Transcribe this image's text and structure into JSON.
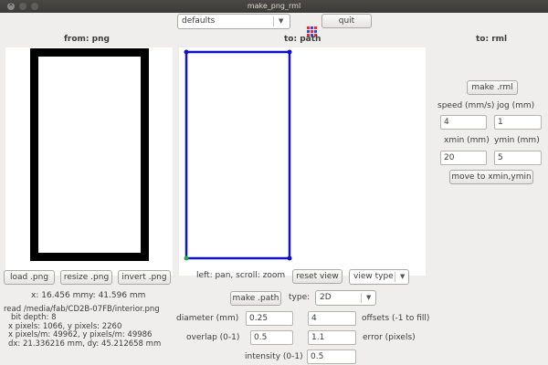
{
  "window": {
    "title": "make_png_rml"
  },
  "toolbar": {
    "defaults_value": "defaults",
    "quit_label": "quit"
  },
  "headings": {
    "from": "from: png",
    "to_path": "to: path",
    "to_rml": "to: rml"
  },
  "png_buttons": {
    "load": "load .png",
    "resize": "resize .png",
    "invert": "invert .png"
  },
  "cursor": {
    "x": "x: 16.456 mm",
    "y": "y: 41.596 mm"
  },
  "info_lines": [
    "read /media/fab/CD2B-07FB/interior.png",
    "bit depth: 8",
    "x pixels: 1066, y pixels: 2260",
    "x pixels/m: 49962, y pixels/m: 49986",
    "dx: 21.336216 mm, dy: 45.212658 mm"
  ],
  "path_controls": {
    "hint": "left: pan, scroll: zoom",
    "reset_view": "reset view",
    "view_type": "view type",
    "make_path": "make .path",
    "type_label": "type:",
    "type_value": "2D",
    "diameter_label": "diameter (mm)",
    "diameter_value": "0.25",
    "offsets_value": "4",
    "offsets_label": "offsets (-1 to fill)",
    "overlap_label": "overlap (0-1)",
    "overlap_value": "0.5",
    "error_value": "1.1",
    "error_label": "error (pixels)",
    "intensity_label": "intensity (0-1)",
    "intensity_value": "0.5"
  },
  "rml": {
    "make_rml": "make .rml",
    "speed_label": "speed (mm/s)",
    "jog_label": "jog (mm)",
    "speed_value": "4",
    "jog_value": "1",
    "xmin_label": "xmin (mm)",
    "ymin_label": "ymin (mm)",
    "xmin_value": "20",
    "ymin_value": "5",
    "move_button": "move to xmin,ymin"
  },
  "colors": {
    "path": "#1111cc",
    "path_start": "#22aa44",
    "palette": [
      "#e03030",
      "#3050d0"
    ]
  }
}
